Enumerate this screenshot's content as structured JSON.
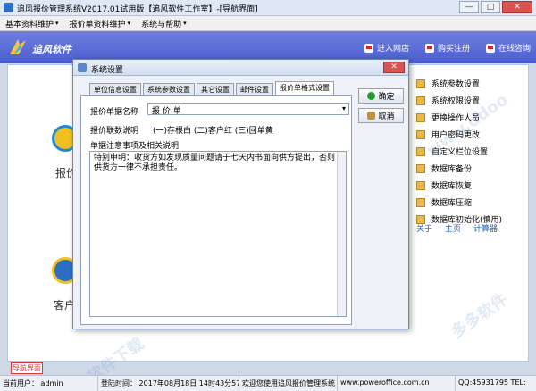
{
  "window": {
    "title": "追风报价管理系统V2017.01试用版【追风软件工作室】-[导航界面]",
    "minimize": "—",
    "maximize": "□",
    "close": "✕"
  },
  "menubar": {
    "items": [
      {
        "label": "基本资料维护",
        "caret": "▾"
      },
      {
        "label": "报价单资料维护",
        "caret": "▾"
      },
      {
        "label": "系统与帮助",
        "caret": "▾"
      }
    ]
  },
  "banner": {
    "logo_text": "追风软件",
    "links": [
      "进入网店",
      "购买注册",
      "在线咨询"
    ]
  },
  "main": {
    "left_labels": [
      "报价",
      "客户"
    ],
    "right_items": [
      "系统参数设置",
      "系统权限设置",
      "更换操作人员",
      "用户密码更改",
      "自定义栏位设置",
      "数据库备份",
      "数据库恢复",
      "数据库压缩",
      "数据库初始化(慎用)"
    ],
    "right_links": [
      "关于",
      "主页",
      "计算器"
    ]
  },
  "dialog": {
    "title": "系统设置",
    "close": "✕",
    "tabs": [
      "单位信息设置",
      "系统参数设置",
      "其它设置",
      "邮件设置",
      "报价单格式设置"
    ],
    "form": {
      "name_label": "报价单据名称",
      "name_value": "报 价 单",
      "select_arrow": "▾",
      "linkage_label": "报价联数说明",
      "linkage_value": "(一)存根白 (二)客户红 (三)回单黄",
      "notes_label": "单据注意事项及相关说明",
      "notes_value": "特别申明：收货方如发现质量问题请于七天内书面向供方提出，否则供货方一律不承担责任。"
    },
    "buttons": {
      "ok": "确定",
      "cancel": "取消"
    }
  },
  "nav_tab": "导航界面",
  "statusbar": {
    "user_label": "当前用户：",
    "user_value": "admin",
    "time_label": "登陆时间：",
    "time_value": "2017年08月18日 14时43分57秒",
    "welcome": "欢迎您使用追风报价管理系统",
    "website": "www.poweroffice.com.cn",
    "qq": "QQ:45931795 TEL:"
  },
  "colors": {
    "banner": "#5566d8",
    "accent": "#d23",
    "link": "#1a5fc8"
  }
}
